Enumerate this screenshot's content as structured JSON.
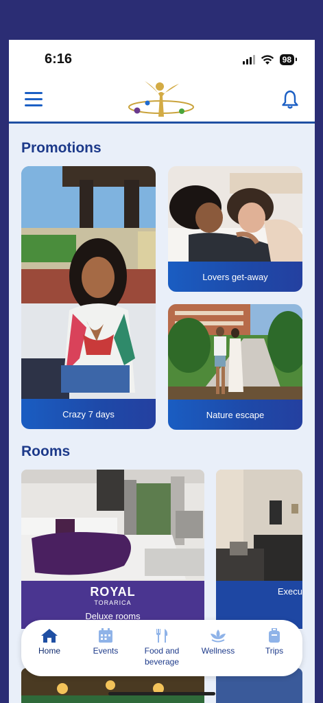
{
  "status_bar": {
    "time": "6:16",
    "battery": "98"
  },
  "header": {
    "menu_icon": "hamburger-menu-icon",
    "logo": "royal-torarica-logo",
    "bell_icon": "bell-icon"
  },
  "promotions": {
    "title": "Promotions",
    "cards": [
      {
        "label": "Crazy 7 days"
      },
      {
        "label": "Lovers get-away"
      },
      {
        "label": "Nature escape"
      }
    ]
  },
  "rooms": {
    "title": "Rooms",
    "cards": [
      {
        "brand": "ROYAL",
        "brand_sub": "TORARICA",
        "label": "Deluxe rooms"
      },
      {
        "brand": "",
        "brand_sub": "",
        "label": "Execu"
      }
    ]
  },
  "nav": {
    "items": [
      {
        "label": "Home",
        "icon": "home-icon"
      },
      {
        "label": "Events",
        "icon": "calendar-icon"
      },
      {
        "label": "Food and beverage",
        "icon": "cutlery-icon"
      },
      {
        "label": "Wellness",
        "icon": "lotus-icon"
      },
      {
        "label": "Trips",
        "icon": "suitcase-icon"
      }
    ]
  },
  "colors": {
    "accent": "#1b5fc4",
    "title": "#1d3a8a",
    "room_purple": "#4a3590",
    "room_blue": "#1e47a3"
  }
}
